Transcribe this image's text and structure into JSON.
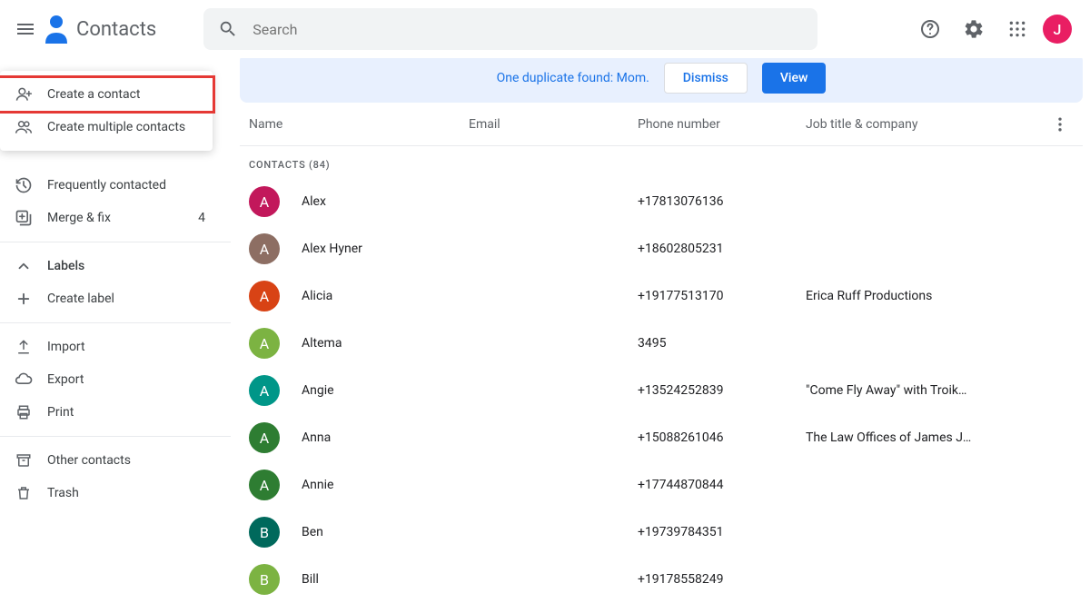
{
  "header": {
    "app_title": "Contacts",
    "search_placeholder": "Search",
    "avatar_initial": "J"
  },
  "create_menu": {
    "create_contact": "Create a contact",
    "create_multiple": "Create multiple contacts"
  },
  "sidebar": {
    "frequently": "Frequently contacted",
    "merge_fix": "Merge & fix",
    "merge_fix_count": "4",
    "labels": "Labels",
    "create_label": "Create label",
    "import": "Import",
    "export": "Export",
    "print": "Print",
    "other_contacts": "Other contacts",
    "trash": "Trash"
  },
  "banner": {
    "text": "One duplicate found: Mom.",
    "dismiss": "Dismiss",
    "view": "View"
  },
  "columns": {
    "name": "Name",
    "email": "Email",
    "phone": "Phone number",
    "job": "Job title & company"
  },
  "section_label": "CONTACTS (84)",
  "contacts": [
    {
      "initial": "A",
      "color": "#c2185b",
      "name": "Alex",
      "phone": "+17813076136",
      "job": ""
    },
    {
      "initial": "A",
      "color": "#8d6e63",
      "name": "Alex Hyner",
      "phone": "+18602805231",
      "job": ""
    },
    {
      "initial": "A",
      "color": "#d84315",
      "name": "Alicia",
      "phone": "+19177513170",
      "job": "Erica Ruff Productions"
    },
    {
      "initial": "A",
      "color": "#7cb342",
      "name": "Altema",
      "phone": "3495",
      "job": ""
    },
    {
      "initial": "A",
      "color": "#009688",
      "name": "Angie",
      "phone": "+13524252839",
      "job": "\"Come Fly Away\" with Troik…"
    },
    {
      "initial": "A",
      "color": "#2e7d32",
      "name": "Anna",
      "phone": "+15088261046",
      "job": "The Law Offices of James J…"
    },
    {
      "initial": "A",
      "color": "#2e7d32",
      "name": "Annie",
      "phone": "+17744870844",
      "job": ""
    },
    {
      "initial": "B",
      "color": "#00695c",
      "name": "Ben",
      "phone": "+19739784351",
      "job": ""
    },
    {
      "initial": "B",
      "color": "#7cb342",
      "name": "Bill",
      "phone": "+19178558249",
      "job": ""
    }
  ]
}
